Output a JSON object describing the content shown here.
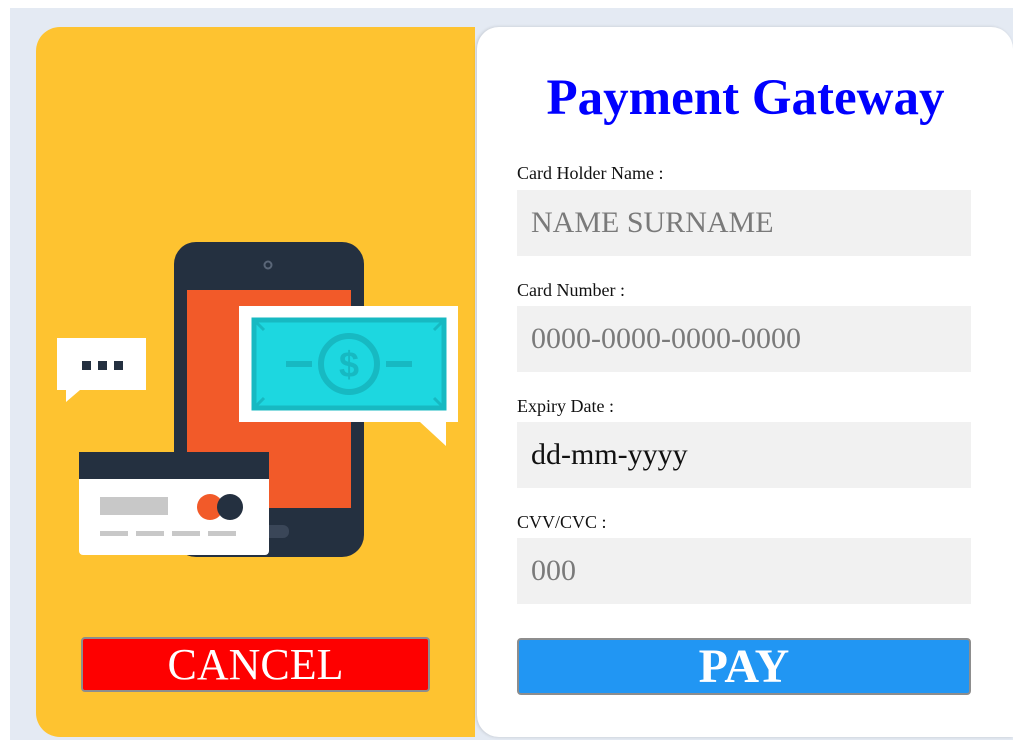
{
  "header": {
    "title": "Payment Gateway"
  },
  "form": {
    "card_holder": {
      "label": "Card Holder Name :",
      "placeholder": "NAME SURNAME"
    },
    "card_number": {
      "label": "Card Number :",
      "placeholder": "0000-0000-0000-0000"
    },
    "expiry": {
      "label": "Expiry Date :",
      "placeholder": "dd-mm-yyyy"
    },
    "cvv": {
      "label": "CVV/CVC :",
      "placeholder": "000"
    }
  },
  "actions": {
    "cancel_label": "CANCEL",
    "pay_label": "PAY"
  },
  "colors": {
    "left_panel_bg": "#fec330",
    "title": "#0000ff",
    "cancel_bg": "#fe0000",
    "pay_bg": "#2196f3",
    "input_bg": "#f1f1f1",
    "phone_body": "#243040",
    "phone_screen": "#f25a29",
    "banknote": "#1dd7e0",
    "card_stripe": "#243040"
  },
  "illustration": {
    "icons": [
      "smartphone-icon",
      "banknote-icon",
      "dollar-icon",
      "chat-bubble-icon",
      "credit-card-icon"
    ]
  }
}
